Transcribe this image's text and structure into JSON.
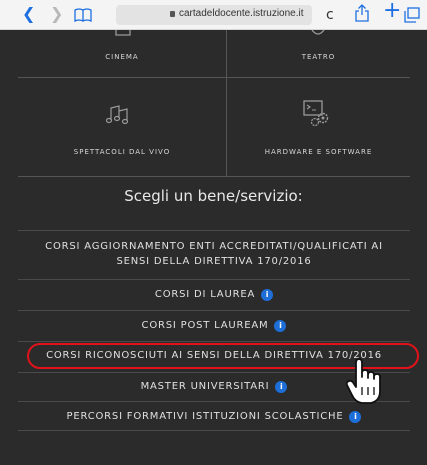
{
  "browser": {
    "back_icon": "chevron-left-icon",
    "forward_icon": "chevron-right-icon",
    "url": "cartadeldocente.istruzione.it",
    "reload_symbol": "c",
    "plus_symbol": "+"
  },
  "categories": [
    {
      "label": "CINEMA",
      "icon": "cinema-icon"
    },
    {
      "label": "TEATRO",
      "icon": "theater-icon"
    },
    {
      "label": "SPETTACOLI DAL VIVO",
      "icon": "music-notes-icon"
    },
    {
      "label": "HARDWARE E SOFTWARE",
      "icon": "computer-gears-icon"
    }
  ],
  "heading": "Scegli un bene/servizio:",
  "items": [
    {
      "line1": "CORSI AGGIORNAMENTO ENTI ACCREDITATI/QUALIFICATI AI",
      "line2": "SENSI DELLA DIRETTIVA 170/2016",
      "info": false
    },
    {
      "label": "CORSI DI LAUREA",
      "info": true
    },
    {
      "label": "CORSI POST LAUREAM",
      "info": true
    },
    {
      "label": "CORSI RICONOSCIUTI AI SENSI DELLA DIRETTIVA 170/2016",
      "info": false
    },
    {
      "label": "MASTER UNIVERSITARI",
      "info": true
    },
    {
      "label": "PERCORSI FORMATIVI ISTITUZIONI SCOLASTICHE",
      "info": true
    }
  ],
  "info_glyph": "i",
  "colors": {
    "background": "#2b2b2b",
    "info": "#1e6ed8",
    "highlight": "#e0131b"
  }
}
